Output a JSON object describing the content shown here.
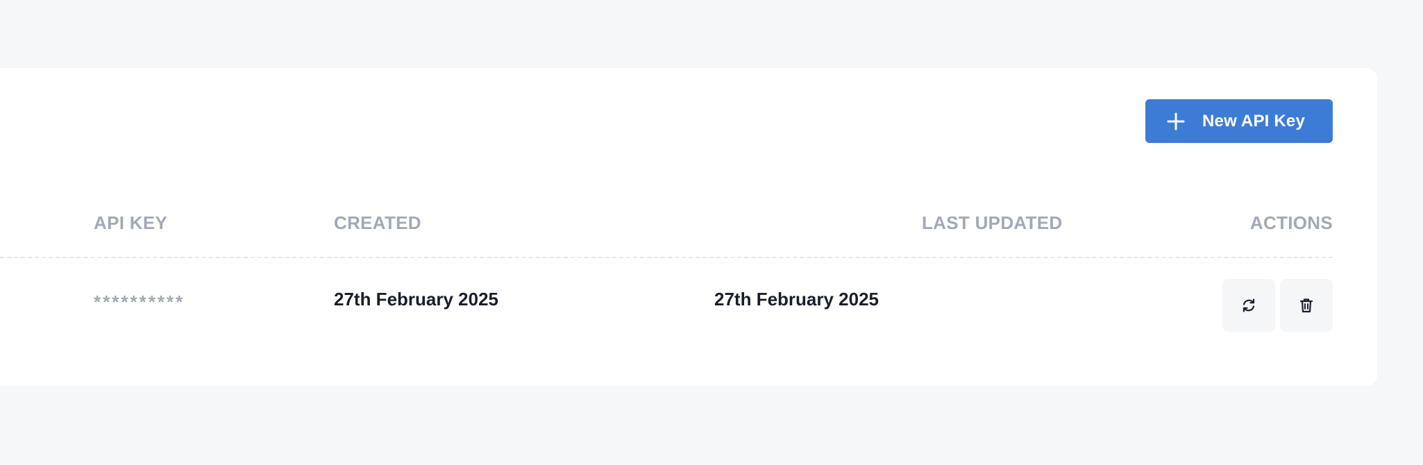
{
  "toolbar": {
    "new_key_label": "New API Key",
    "accent_color": "#3d7cd6"
  },
  "table": {
    "headers": {
      "api_key": "API KEY",
      "created": "CREATED",
      "last_updated": "LAST UPDATED",
      "actions": "ACTIONS"
    },
    "rows": [
      {
        "api_key": "**********",
        "created": "27th February 2025",
        "last_updated": "27th February 2025",
        "actions": [
          "refresh-icon",
          "trash-icon"
        ]
      }
    ]
  }
}
